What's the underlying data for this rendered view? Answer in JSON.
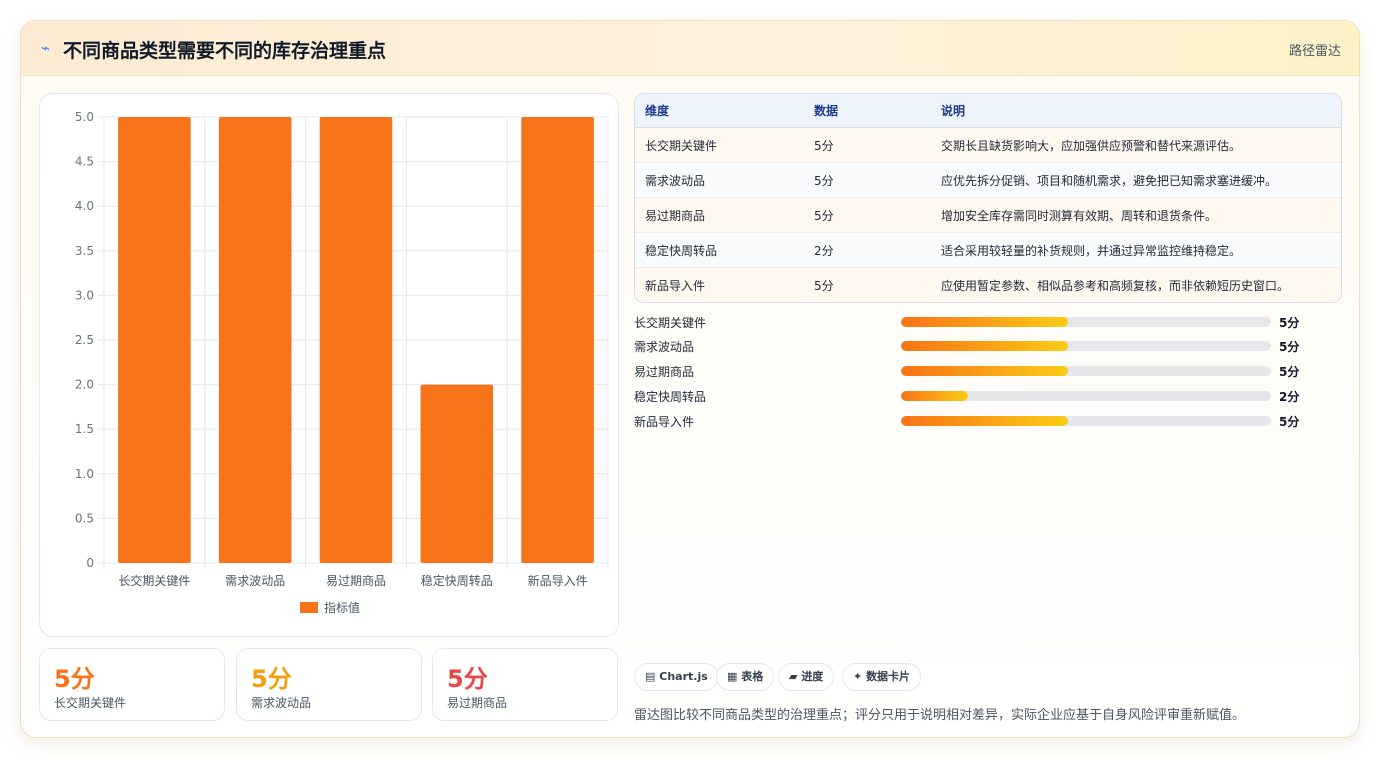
{
  "header": {
    "icon": "bolt-icon",
    "title": "不同商品类型需要不同的库存治理重点",
    "tag": "路径雷达"
  },
  "chart_data": {
    "type": "bar",
    "categories": [
      "长交期关键件",
      "需求波动品",
      "易过期商品",
      "稳定快周转品",
      "新品导入件"
    ],
    "series": [
      {
        "name": "指标值",
        "values": [
          5,
          5,
          5,
          2,
          5
        ],
        "color": "#f7731a"
      }
    ],
    "ylim": [
      0,
      5
    ],
    "yticks": [
      "0",
      "0.5",
      "1.0",
      "1.5",
      "2.0",
      "2.5",
      "3.0",
      "3.5",
      "4.0",
      "4.5",
      "5.0"
    ],
    "grid": true,
    "legend_position": "bottom"
  },
  "stats": [
    {
      "value": "5分",
      "label": "长交期关键件",
      "color": "#f97316"
    },
    {
      "value": "5分",
      "label": "需求波动品",
      "color": "#f59e0b"
    },
    {
      "value": "5分",
      "label": "易过期商品",
      "color": "#ef4444"
    }
  ],
  "table": {
    "headers": [
      "维度",
      "数据",
      "说明"
    ],
    "rows": [
      [
        "长交期关键件",
        "5分",
        "交期长且缺货影响大，应加强供应预警和替代来源评估。"
      ],
      [
        "需求波动品",
        "5分",
        "应优先拆分促销、项目和随机需求，避免把已知需求塞进缓冲。"
      ],
      [
        "易过期商品",
        "5分",
        "增加安全库存需同时测算有效期、周转和退货条件。"
      ],
      [
        "稳定快周转品",
        "2分",
        "适合采用较轻量的补货规则，并通过异常监控维持稳定。"
      ],
      [
        "新品导入件",
        "5分",
        "应使用暂定参数、相似品参考和高频复核，而非依赖短历史窗口。"
      ]
    ]
  },
  "progress": [
    {
      "label": "长交期关键件",
      "value": "5分",
      "fraction": 0.45
    },
    {
      "label": "需求波动品",
      "value": "5分",
      "fraction": 0.45
    },
    {
      "label": "易过期商品",
      "value": "5分",
      "fraction": 0.45
    },
    {
      "label": "稳定快周转品",
      "value": "2分",
      "fraction": 0.18
    },
    {
      "label": "新品导入件",
      "value": "5分",
      "fraction": 0.45
    }
  ],
  "chips": [
    {
      "icon": "chart-icon",
      "glyph": "▤",
      "label": "Chart.js"
    },
    {
      "icon": "table-icon",
      "glyph": "▦",
      "label": "表格"
    },
    {
      "icon": "progress-icon",
      "glyph": "▰",
      "label": "进度"
    },
    {
      "icon": "card-icon",
      "glyph": "✦",
      "label": "数据卡片"
    }
  ],
  "note": "雷达图比较不同商品类型的治理重点；评分只用于说明相对差异，实际企业应基于自身风险评审重新赋值。"
}
